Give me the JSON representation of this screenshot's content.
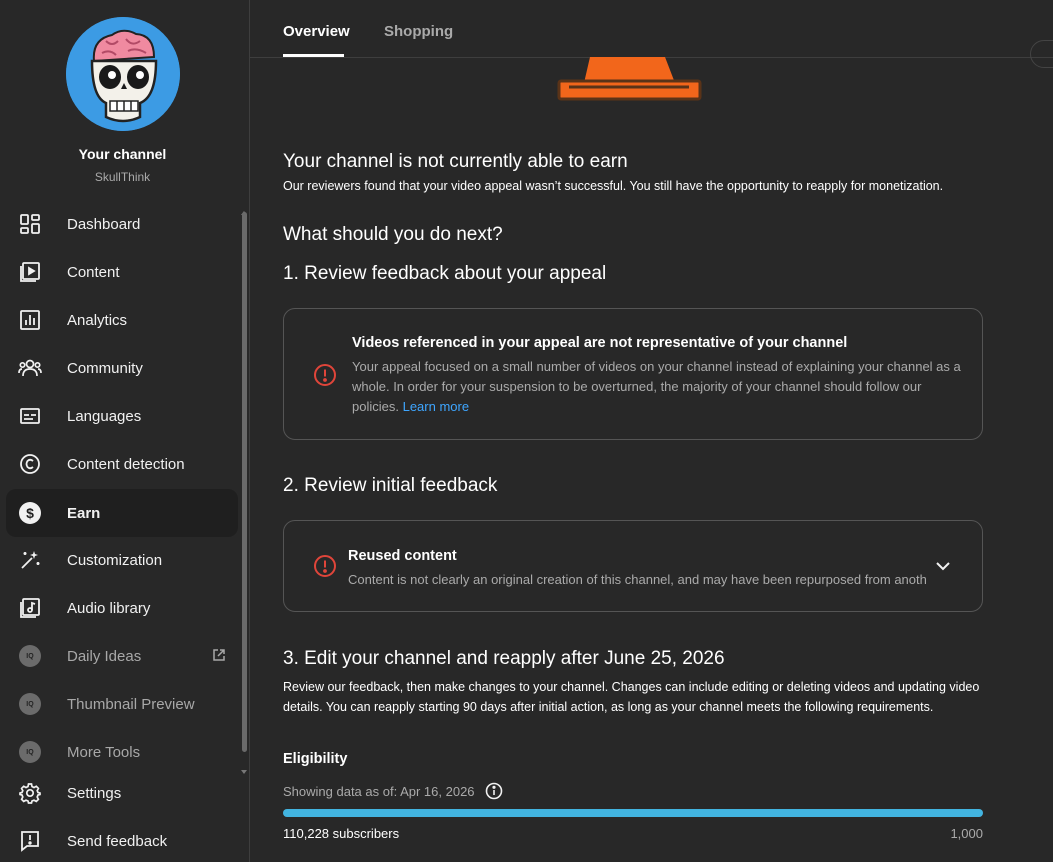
{
  "sidebar": {
    "channel_title": "Your channel",
    "channel_handle": "SkullThink",
    "items": [
      {
        "label": "Dashboard",
        "icon": "dashboard-icon"
      },
      {
        "label": "Content",
        "icon": "content-icon"
      },
      {
        "label": "Analytics",
        "icon": "analytics-icon"
      },
      {
        "label": "Community",
        "icon": "community-icon"
      },
      {
        "label": "Languages",
        "icon": "languages-icon"
      },
      {
        "label": "Content detection",
        "icon": "copyright-icon"
      },
      {
        "label": "Earn",
        "icon": "dollar-icon",
        "active": true
      },
      {
        "label": "Customization",
        "icon": "magic-wand-icon"
      },
      {
        "label": "Audio library",
        "icon": "audio-library-icon"
      },
      {
        "label": "Daily Ideas",
        "icon": "iq-icon",
        "external": true
      },
      {
        "label": "Thumbnail Preview",
        "icon": "iq-icon"
      },
      {
        "label": "More Tools",
        "icon": "iq-icon"
      },
      {
        "label": "Settings",
        "icon": "gear-icon"
      },
      {
        "label": "Send feedback",
        "icon": "feedback-icon"
      }
    ]
  },
  "tabs": [
    {
      "label": "Overview",
      "active": true
    },
    {
      "label": "Shopping",
      "active": false
    }
  ],
  "status": {
    "heading": "Your channel is not currently able to earn",
    "subtext": "Our reviewers found that your video appeal wasn’t successful. You still have the opportunity to reapply for monetization."
  },
  "next_heading": "What should you do next?",
  "step1": {
    "heading": "1. Review feedback about your appeal",
    "card_title": "Videos referenced in your appeal are not representative of your channel",
    "card_body": "Your appeal focused on a small number of videos on your channel instead of explaining your channel as a whole. In order for your suspension to be overturned, the majority of your channel should follow our policies.",
    "link": "Learn more"
  },
  "step2": {
    "heading": "2. Review initial feedback",
    "card_title": "Reused content",
    "card_body": "Content is not clearly an original creation of this channel, and may have been repurposed from anoth"
  },
  "step3": {
    "heading": "3. Edit your channel and reapply after June 25, 2026",
    "body": "Review our feedback, then make changes to your channel. Changes can include editing or deleting videos and updating video details. You can reapply starting 90 days after initial action, as long as your channel meets the following requirements."
  },
  "eligibility": {
    "heading": "Eligibility",
    "showing": "Showing data as of: Apr 16, 2026",
    "subscribers_text": "110,228 subscribers",
    "target": "1,000",
    "progress": 1.0
  },
  "colors": {
    "accent_link": "#3ea6ff",
    "warning_red": "#e0453a",
    "progress_blue": "#42b4e0",
    "cone_orange": "#f2661b"
  }
}
